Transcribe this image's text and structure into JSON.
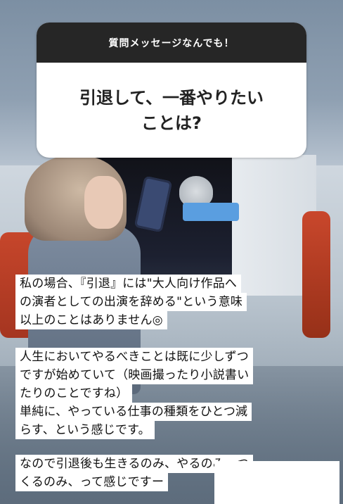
{
  "question_sticker": {
    "header": "質問メッセージなんでも！",
    "question_line1": "引退して、一番やりたい",
    "question_line2": "ことは?"
  },
  "caption": {
    "block1": [
      "私の場合、『引退』には\"大人向け作品へ",
      "の演者としての出演を辞める\"という意味",
      "以上のことはありません◎"
    ],
    "block2": [
      "人生においてやるべきことは既に少しずつ",
      "ですが始めていて（映画撮ったり小説書い",
      "たりのことですね）",
      "単純に、やっている仕事の種類をひとつ減",
      "らす、という感じです。"
    ],
    "block3": [
      "なので引退後も生きるのみ、やるのみ、つ",
      "くるのみ、って感じですー"
    ]
  },
  "colors": {
    "sticker_header_bg": "#262626",
    "sticker_body_bg": "#ffffff",
    "caption_bg": "#ffffff"
  }
}
